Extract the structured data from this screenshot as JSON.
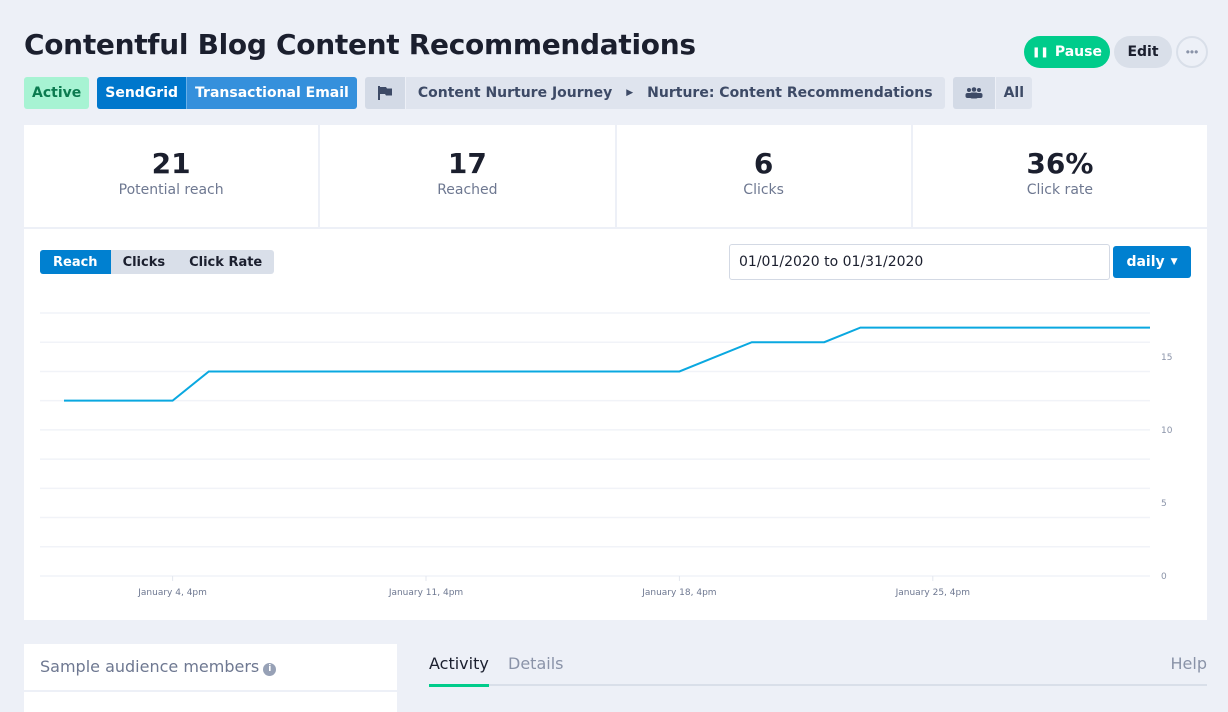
{
  "title": "Contentful Blog Content Recommendations",
  "actions": {
    "pause": "Pause",
    "edit": "Edit",
    "more": "•••"
  },
  "tags": {
    "status": "Active",
    "provider": "SendGrid",
    "type": "Transactional Email",
    "journey": "Content Nurture Journey",
    "step": "Nurture: Content Recommendations",
    "audience": "All"
  },
  "stats": [
    {
      "value": "21",
      "label": "Potential reach"
    },
    {
      "value": "17",
      "label": "Reached"
    },
    {
      "value": "6",
      "label": "Clicks"
    },
    {
      "value": "36%",
      "label": "Click rate"
    }
  ],
  "chart_controls": {
    "tabs": [
      "Reach",
      "Clicks",
      "Click Rate"
    ],
    "active_tab": "Reach",
    "date_range": "01/01/2020 to 01/31/2020",
    "interval": "daily"
  },
  "chart_data": {
    "type": "line",
    "x": [
      "2020-01-01",
      "2020-01-02",
      "2020-01-03",
      "2020-01-04",
      "2020-01-05",
      "2020-01-06",
      "2020-01-07",
      "2020-01-08",
      "2020-01-09",
      "2020-01-10",
      "2020-01-11",
      "2020-01-12",
      "2020-01-13",
      "2020-01-14",
      "2020-01-15",
      "2020-01-16",
      "2020-01-17",
      "2020-01-18",
      "2020-01-19",
      "2020-01-20",
      "2020-01-21",
      "2020-01-22",
      "2020-01-23",
      "2020-01-24",
      "2020-01-25",
      "2020-01-26",
      "2020-01-27",
      "2020-01-28",
      "2020-01-29",
      "2020-01-30",
      "2020-01-31"
    ],
    "values": [
      12,
      12,
      12,
      12,
      14,
      14,
      14,
      14,
      14,
      14,
      14,
      14,
      14,
      14,
      14,
      14,
      14,
      14,
      15,
      16,
      16,
      16,
      17,
      17,
      17,
      17,
      17,
      17,
      17,
      17,
      17
    ],
    "xticks": [
      "January 4, 4pm",
      "January 11, 4pm",
      "January 18, 4pm",
      "January 25, 4pm"
    ],
    "yticks": [
      "0",
      "5",
      "10",
      "15"
    ],
    "ylim": [
      0,
      18
    ],
    "grid": true,
    "color": "#0aa8e0"
  },
  "bottom": {
    "sample_title": "Sample audience members",
    "tabs": [
      "Activity",
      "Details"
    ],
    "help": "Help"
  },
  "colors": {
    "accent": "#0080d0",
    "success": "#00cc8b"
  }
}
